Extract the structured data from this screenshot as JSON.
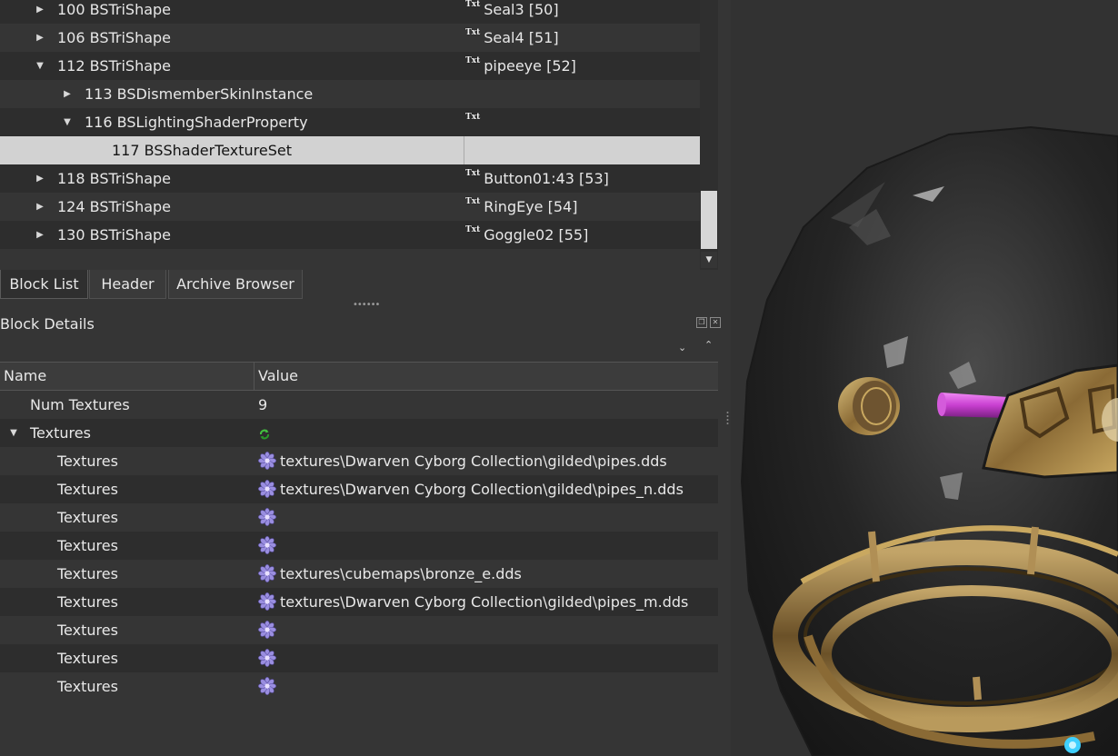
{
  "block_tree": {
    "rows": [
      {
        "expander": "collapsed",
        "name": "100 BSTriShape",
        "value": "Seal3 [50]",
        "txt": true
      },
      {
        "expander": "collapsed",
        "name": "106 BSTriShape",
        "value": "Seal4 [51]",
        "txt": true
      },
      {
        "expander": "expanded",
        "name": "112 BSTriShape",
        "value": "pipeeye [52]",
        "txt": true
      },
      {
        "expander": "collapsed",
        "name": "113 BSDismemberSkinInstance",
        "value": "",
        "txt": false
      },
      {
        "expander": "expanded",
        "name": "116 BSLightingShaderProperty",
        "value": "",
        "txt": true
      },
      {
        "expander": "none",
        "name": "117 BSShaderTextureSet",
        "value": "",
        "txt": false,
        "selected": true
      },
      {
        "expander": "collapsed",
        "name": "118 BSTriShape",
        "value": "Button01:43 [53]",
        "txt": true
      },
      {
        "expander": "collapsed",
        "name": "124 BSTriShape",
        "value": "RingEye [54]",
        "txt": true
      },
      {
        "expander": "collapsed",
        "name": "130 BSTriShape",
        "value": "Goggle02 [55]",
        "txt": true
      }
    ],
    "txt_badge": "Txt"
  },
  "tabs": [
    "Block List",
    "Header",
    "Archive Browser"
  ],
  "block_details": {
    "title": "Block Details",
    "columns": {
      "name": "Name",
      "value": "Value"
    },
    "rows": [
      {
        "name": "Num Textures",
        "value": "9",
        "icon": "none"
      },
      {
        "name": "Textures",
        "value": "",
        "icon": "refresh-icon",
        "expander": "expanded"
      },
      {
        "name": "Textures",
        "value": "textures\\Dwarven Cyborg Collection\\gilded\\pipes.dds",
        "icon": "flower-icon"
      },
      {
        "name": "Textures",
        "value": "textures\\Dwarven Cyborg Collection\\gilded\\pipes_n.dds",
        "icon": "flower-icon"
      },
      {
        "name": "Textures",
        "value": "",
        "icon": "flower-icon"
      },
      {
        "name": "Textures",
        "value": "",
        "icon": "flower-icon"
      },
      {
        "name": "Textures",
        "value": "textures\\cubemaps\\bronze_e.dds",
        "icon": "flower-icon"
      },
      {
        "name": "Textures",
        "value": "textures\\Dwarven Cyborg Collection\\gilded\\pipes_m.dds",
        "icon": "flower-icon"
      },
      {
        "name": "Textures",
        "value": "",
        "icon": "flower-icon"
      },
      {
        "name": "Textures",
        "value": "",
        "icon": "flower-icon"
      },
      {
        "name": "Textures",
        "value": "",
        "icon": "flower-icon"
      }
    ]
  },
  "colors": {
    "panel_bg": "#353535",
    "row_alt": "#2d2d2d",
    "selection": "#d2d2d2",
    "viewport_bg": "#323232",
    "bronze": "#a88a50",
    "glass_highlight": "#bfbfbf",
    "magenta_pipe": "#c83fd0",
    "cyan_gem": "#3fd0ff"
  }
}
